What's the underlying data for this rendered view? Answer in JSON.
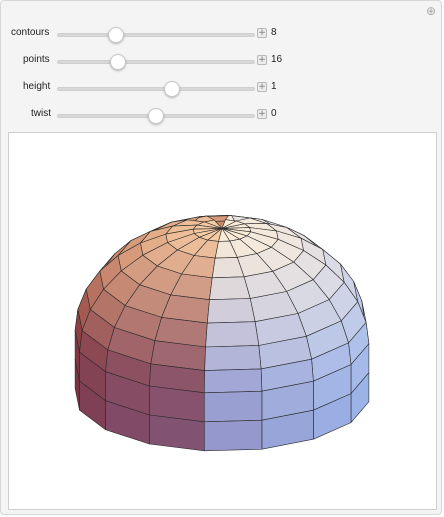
{
  "controls": [
    {
      "label": "contours",
      "value": "8",
      "fraction": 0.3
    },
    {
      "label": "points",
      "value": "16",
      "fraction": 0.31
    },
    {
      "label": "height",
      "value": "1",
      "fraction": 0.58
    },
    {
      "label": "twist",
      "value": "0",
      "fraction": 0.5
    }
  ],
  "icons": {
    "corner": "plus-icon",
    "stepper": "plus-icon"
  },
  "surface": {
    "contours": 8,
    "points": 16,
    "height": 1,
    "twist": 0,
    "colors": {
      "top": "#fde9c9",
      "orange": "#e88a4e",
      "maroon": "#7b2f3c",
      "purple": "#8a76ab",
      "blue": "#9bb3e7",
      "white": "#f7f4fa",
      "edge": "#2a2a2a"
    }
  }
}
